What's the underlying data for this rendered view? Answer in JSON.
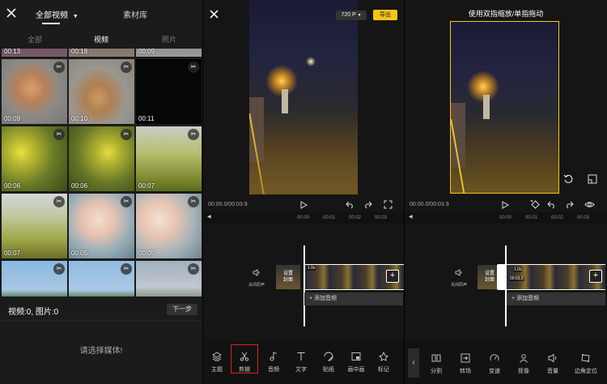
{
  "picker": {
    "top_tabs": [
      "全部视频",
      "素材库"
    ],
    "sub_tabs": [
      "全部",
      "视频",
      "照片"
    ],
    "tiles": [
      {
        "dur": "00:13"
      },
      {
        "dur": "00:18"
      },
      {
        "dur": "00:09"
      },
      {
        "dur": "00:09"
      },
      {
        "dur": "00:10"
      },
      {
        "dur": "00:11"
      },
      {
        "dur": "00:06"
      },
      {
        "dur": "00:06"
      },
      {
        "dur": "00:07"
      },
      {
        "dur": "00:07"
      },
      {
        "dur": "00:05"
      },
      {
        "dur": "00:05"
      },
      {
        "dur": ""
      },
      {
        "dur": ""
      },
      {
        "dur": ""
      }
    ],
    "count_text": "视频:0, 图片:0",
    "next_label": "下一步",
    "prompt": "请选择媒体!"
  },
  "editor": {
    "resolution": "720 P",
    "export_label": "导出",
    "time": "00:00.0/00:03.9",
    "ruler": [
      "00:00",
      "00:01",
      "00:02",
      "00:03"
    ],
    "mute_label": "关闭原声",
    "cover_label": "设置\n封面",
    "clip_speed": "1.0x",
    "add_audio": "+ 添加音频",
    "toolbar": [
      "主题",
      "剪辑",
      "音频",
      "文字",
      "贴纸",
      "画中画",
      "标记"
    ]
  },
  "crop": {
    "hint": "使用双指缩放/单指拖动",
    "time": "00:00.0/00:03.9",
    "ruler": [
      "00:00",
      "00:01",
      "00:02",
      "00:03"
    ],
    "mute_label": "关闭原声",
    "cover_label": "设置\n封面",
    "clip_speed": "1.0x",
    "clip_time": "00:03.9",
    "add_audio": "+ 添加音频",
    "toolbar": [
      "分割",
      "转场",
      "变速",
      "抠像",
      "音量",
      "边角定位"
    ]
  },
  "colors": {
    "accent_yellow": "#f5c518",
    "selection_red": "#e02020"
  }
}
